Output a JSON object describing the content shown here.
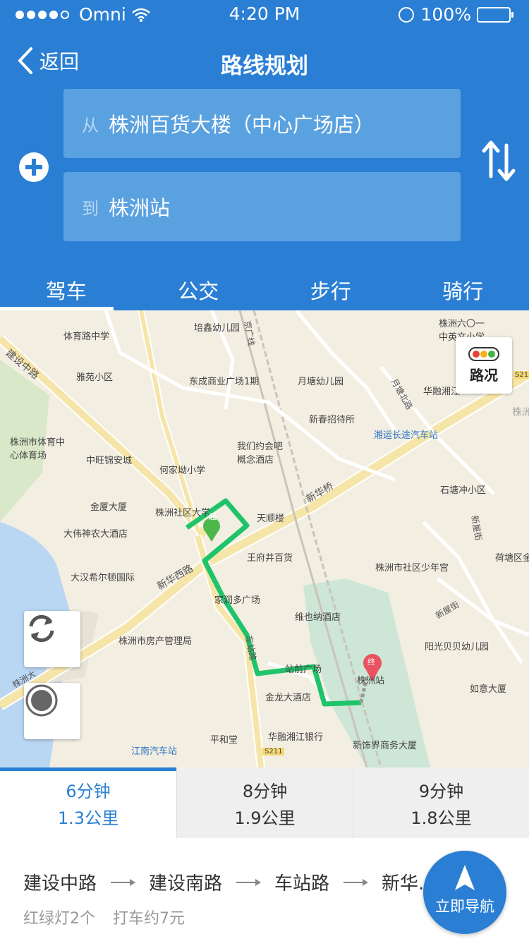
{
  "status_bar": {
    "carrier": "Omni",
    "time": "4:20 PM",
    "battery": "100%"
  },
  "navbar": {
    "back_label": "返回",
    "title": "路线规划"
  },
  "route_inputs": {
    "from_prefix": "从",
    "from_value": "株洲百货大楼（中心广场店）",
    "to_prefix": "到",
    "to_value": "株洲站"
  },
  "tabs": [
    {
      "label": "驾车",
      "active": true
    },
    {
      "label": "公交",
      "active": false
    },
    {
      "label": "步行",
      "active": false
    },
    {
      "label": "骑行",
      "active": false
    }
  ],
  "map": {
    "traffic_label": "路况",
    "pois": [
      "体育路中学",
      "培鑫幼儿园",
      "株洲六〇一中英文小学",
      "建设中路",
      "雅苑小区",
      "东成商业广场1期",
      "月塘幼儿园",
      "月塘北路",
      "华融湘江",
      "株洲市体育中心体育场",
      "新春招待所",
      "湘运长途汽车站",
      "中旺锦安城",
      "我们约会吧概念酒店",
      "何家坳小学",
      "石塘冲小区",
      "金厦大厦",
      "株洲社区大学",
      "天顺楼",
      "新华桥",
      "大伟神农大酒店",
      "王府井百货",
      "株洲市社区少年宫",
      "荷塘区金",
      "大汉希尔顿国际",
      "新华西路",
      "家润多广场",
      "维也纳酒店",
      "新屋街",
      "株洲市房产管理局",
      "阳光贝贝幼儿园",
      "株洲大",
      "站前广场",
      "株洲站",
      "如意大厦",
      "金龙大酒店",
      "平和堂",
      "华融湘江银行",
      "新饰界商务大厦",
      "江南汽车站",
      "S211",
      "起",
      "终",
      "京广线",
      "车站路",
      "新屋街",
      "S211",
      "株洲"
    ]
  },
  "route_options": [
    {
      "time": "6分钟",
      "distance": "1.3公里",
      "active": true
    },
    {
      "time": "8分钟",
      "distance": "1.9公里",
      "active": false
    },
    {
      "time": "9分钟",
      "distance": "1.8公里",
      "active": false
    }
  ],
  "route_detail": {
    "steps": [
      "建设中路",
      "建设南路",
      "车站路",
      "新华..."
    ],
    "traffic_lights": "红绿灯2个",
    "taxi_fare": "打车约7元"
  },
  "navigate_button": {
    "label": "立即导航"
  },
  "colors": {
    "primary": "#2a7fd4",
    "route_green": "#1fc46a",
    "map_bg": "#f3eee2"
  }
}
